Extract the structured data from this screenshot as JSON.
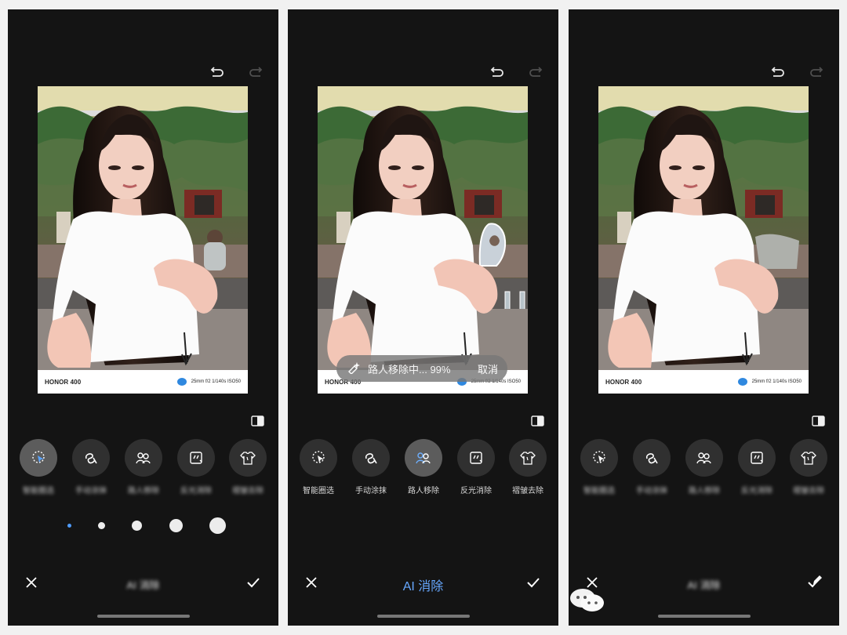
{
  "screens": [
    {
      "id": "left",
      "tools": [
        {
          "icon": "smart-select-icon",
          "label": "智能圈选",
          "blurred": true,
          "active": true
        },
        {
          "icon": "manual-brush-icon",
          "label": "手动涂抹",
          "blurred": true
        },
        {
          "icon": "person-remove-icon",
          "label": "路人移除",
          "blurred": true
        },
        {
          "icon": "reflection-remove-icon",
          "label": "反光消除",
          "blurred": true
        },
        {
          "icon": "wrinkle-remove-icon",
          "label": "褶皱去除",
          "blurred": true
        }
      ],
      "bottom": {
        "title": "AI 消除",
        "title_blurred": true
      }
    },
    {
      "id": "middle",
      "progress": {
        "text": "路人移除中... 99%",
        "cancel": "取消",
        "percent": 99
      },
      "tools": [
        {
          "icon": "smart-select-icon",
          "label": "智能圈选"
        },
        {
          "icon": "manual-brush-icon",
          "label": "手动涂抹"
        },
        {
          "icon": "person-remove-icon",
          "label": "路人移除",
          "active": true
        },
        {
          "icon": "reflection-remove-icon",
          "label": "反光消除"
        },
        {
          "icon": "wrinkle-remove-icon",
          "label": "褶皱去除"
        }
      ],
      "bottom": {
        "title": "AI 消除",
        "title_blurred": false
      }
    },
    {
      "id": "right",
      "tools": [
        {
          "icon": "smart-select-icon",
          "label": "智能圈选",
          "blurred": true
        },
        {
          "icon": "manual-brush-icon",
          "label": "手动涂抹",
          "blurred": true
        },
        {
          "icon": "person-remove-icon",
          "label": "路人移除",
          "blurred": true
        },
        {
          "icon": "reflection-remove-icon",
          "label": "反光消除",
          "blurred": true
        },
        {
          "icon": "wrinkle-remove-icon",
          "label": "褶皱去除",
          "blurred": true
        }
      ],
      "bottom": {
        "title": "AI 消除",
        "title_blurred": true
      }
    }
  ],
  "photo_watermark": {
    "brand": "HONOR 400",
    "exif": "25mm  f/2  1/140s  ISO50"
  },
  "colors": {
    "accent": "#67a8ff",
    "screen_bg": "#141414",
    "tool_bg": "#303030",
    "tool_active": "#5c5c5c"
  }
}
